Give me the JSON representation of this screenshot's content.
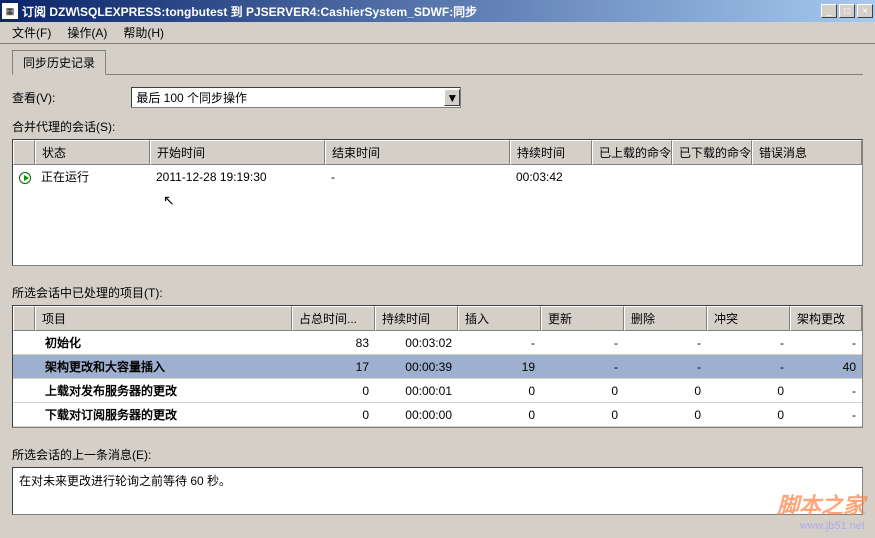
{
  "window": {
    "title": "订阅 DZW\\SQLEXPRESS:tongbutest 到 PJSERVER4:CashierSystem_SDWF:同步"
  },
  "menu": {
    "file": "文件(F)",
    "action": "操作(A)",
    "help": "帮助(H)"
  },
  "tab": "同步历史记录",
  "view_label": "查看(V):",
  "view_value": "最后 100 个同步操作",
  "sessions_label": "合并代理的会话(S):",
  "sessions_headers": [
    "",
    "状态",
    "开始时间",
    "结束时间",
    "持续时间",
    "已上载的命令",
    "已下载的命令",
    "错误消息"
  ],
  "session_row": {
    "status": "正在运行",
    "start": "2011-12-28 19:19:30",
    "end": "-",
    "duration": "00:03:42",
    "up": "",
    "down": "",
    "err": ""
  },
  "items_label": "所选会话中已处理的项目(T):",
  "items_headers": [
    "",
    "项目",
    "占总时间...",
    "持续时间",
    "插入",
    "更新",
    "删除",
    "冲突",
    "架构更改"
  ],
  "items_rows": [
    {
      "proj": "初始化",
      "pct": "83",
      "dur": "00:03:02",
      "ins": "-",
      "upd": "-",
      "del": "-",
      "conf": "-",
      "schema": "-",
      "sel": false
    },
    {
      "proj": "架构更改和大容量插入",
      "pct": "17",
      "dur": "00:00:39",
      "ins": "19",
      "upd": "-",
      "del": "-",
      "conf": "-",
      "schema": "40",
      "sel": true
    },
    {
      "proj": "上载对发布服务器的更改",
      "pct": "0",
      "dur": "00:00:01",
      "ins": "0",
      "upd": "0",
      "del": "0",
      "conf": "0",
      "schema": "-",
      "sel": false
    },
    {
      "proj": "下载对订阅服务器的更改",
      "pct": "0",
      "dur": "00:00:00",
      "ins": "0",
      "upd": "0",
      "del": "0",
      "conf": "0",
      "schema": "-",
      "sel": false
    }
  ],
  "lastmsg_label": "所选会话的上一条消息(E):",
  "lastmsg_text": "在对未来更改进行轮询之前等待 60 秒。",
  "watermark": {
    "site": "脚本之家",
    "url": "www.jb51.net"
  }
}
